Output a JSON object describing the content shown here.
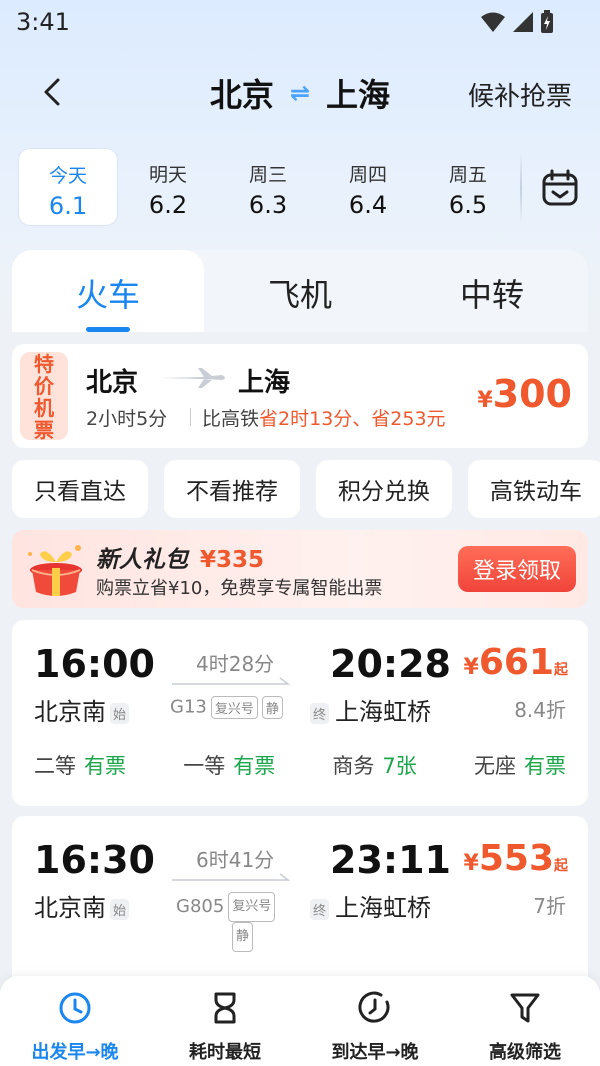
{
  "status": {
    "time": "3:41"
  },
  "header": {
    "from": "北京",
    "swap": "⇌",
    "to": "上海",
    "waitlist": "候补抢票"
  },
  "dates": [
    {
      "weekday": "今天",
      "date": "6.1",
      "active": true
    },
    {
      "weekday": "明天",
      "date": "6.2",
      "active": false
    },
    {
      "weekday": "周三",
      "date": "6.3",
      "active": false
    },
    {
      "weekday": "周四",
      "date": "6.4",
      "active": false
    },
    {
      "weekday": "周五",
      "date": "6.5",
      "active": false
    }
  ],
  "tabs": [
    {
      "label": "火车",
      "active": true
    },
    {
      "label": "飞机",
      "active": false
    },
    {
      "label": "中转",
      "active": false
    }
  ],
  "flight_card": {
    "badge": "特价机票",
    "from": "北京",
    "to": "上海",
    "duration": "2小时5分",
    "compare_prefix": "比高铁",
    "compare_highlight": "省2时13分、省253元",
    "currency": "¥",
    "price": "300"
  },
  "chips": [
    "只看直达",
    "不看推荐",
    "积分兑换",
    "高铁动车"
  ],
  "promo": {
    "title": "新人礼包",
    "amount": "¥335",
    "subtitle": "购票立省¥10，免费享专属智能出票",
    "button": "登录领取"
  },
  "trains": [
    {
      "depart": "16:00",
      "depart_station": "北京南",
      "depart_tag": "始",
      "duration": "4时28分",
      "code": "G13",
      "tags": [
        "复兴号",
        "静"
      ],
      "arrive": "20:28",
      "arrive_station": "上海虹桥",
      "arrive_tag": "终",
      "currency": "¥",
      "price": "661",
      "price_suffix": "起",
      "discount": "8.4折",
      "seats": [
        {
          "name": "二等",
          "status": "有票"
        },
        {
          "name": "一等",
          "status": "有票"
        },
        {
          "name": "商务",
          "status": "7张"
        },
        {
          "name": "无座",
          "status": "有票"
        }
      ]
    },
    {
      "depart": "16:30",
      "depart_station": "北京南",
      "depart_tag": "始",
      "duration": "6时41分",
      "code": "G805",
      "tags": [
        "复兴号",
        "静"
      ],
      "arrive": "23:11",
      "arrive_station": "上海虹桥",
      "arrive_tag": "终",
      "currency": "¥",
      "price": "553",
      "price_suffix": "起",
      "discount": "7折"
    }
  ],
  "bottom_nav": [
    {
      "label": "出发早→晚",
      "icon": "clock-icon",
      "active": true
    },
    {
      "label": "耗时最短",
      "icon": "hourglass-icon",
      "active": false
    },
    {
      "label": "到达早→晚",
      "icon": "clock-arrive-icon",
      "active": false
    },
    {
      "label": "高级筛选",
      "icon": "filter-icon",
      "active": false
    }
  ],
  "colors": {
    "accent": "#1a86f0",
    "price": "#f0582e",
    "available": "#1aa64b"
  }
}
